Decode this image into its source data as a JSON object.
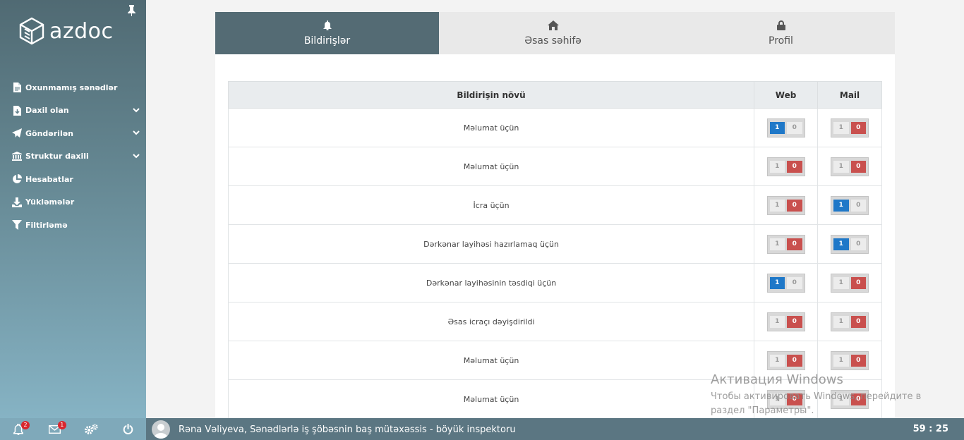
{
  "brand": {
    "name": "azdoc"
  },
  "sidebar": {
    "items": [
      {
        "label": "Oxunmamış sənədlər",
        "icon": "document-icon",
        "has_submenu": false
      },
      {
        "label": "Daxil olan",
        "icon": "inbox-download-icon",
        "has_submenu": true
      },
      {
        "label": "Göndərilən",
        "icon": "paper-plane-icon",
        "has_submenu": true
      },
      {
        "label": "Struktur daxili",
        "icon": "institution-icon",
        "has_submenu": true
      },
      {
        "label": "Hesabatlar",
        "icon": "pie-chart-icon",
        "has_submenu": false
      },
      {
        "label": "Yükləmələr",
        "icon": "download-icon",
        "has_submenu": false
      },
      {
        "label": "Filtirləmə",
        "icon": "filter-icon",
        "has_submenu": false
      }
    ]
  },
  "tabs": [
    {
      "label": "Bildirişlər",
      "icon": "bell-icon",
      "active": true
    },
    {
      "label": "Əsas səhifə",
      "icon": "home-icon",
      "active": false
    },
    {
      "label": "Profil",
      "icon": "lock-icon",
      "active": false
    }
  ],
  "table": {
    "headers": {
      "type": "Bildirişin növü",
      "web": "Web",
      "mail": "Mail"
    },
    "rows": [
      {
        "type": "Məlumat üçün",
        "web": "1",
        "mail": "0"
      },
      {
        "type": "Məlumat üçün",
        "web": "0",
        "mail": "0"
      },
      {
        "type": "İcra üçün",
        "web": "0",
        "mail": "1"
      },
      {
        "type": "Dərkənar layihəsi hazırlamaq üçün",
        "web": "0",
        "mail": "1"
      },
      {
        "type": "Dərkənar layihəsinin təsdiqi üçün",
        "web": "1",
        "mail": "0"
      },
      {
        "type": "Əsas icraçı dəyişdirildi",
        "web": "0",
        "mail": "0"
      },
      {
        "type": "Məlumat üçün",
        "web": "0",
        "mail": "0"
      },
      {
        "type": "Məlumat üçün",
        "web": "0",
        "mail": "0"
      }
    ],
    "toggle_labels": {
      "one": "1",
      "zero": "0"
    }
  },
  "bottombar": {
    "notifications_count": "2",
    "messages_count": "1",
    "user_text": "Rəna Vəliyeva, Sənədlərlə iş şöbəsnin baş mütəxəssis - böyük inspektoru",
    "timer": "59 : 25"
  },
  "watermark": {
    "title": "Активация Windows",
    "text": "Чтобы активировать Windows, перейдите в раздел \"Параметры\"."
  },
  "colors": {
    "toggle_on": "#1f78c8",
    "toggle_off": "#c9504e",
    "sidebar_top": "#506a73",
    "sidebar_bottom": "#86b3c4"
  }
}
